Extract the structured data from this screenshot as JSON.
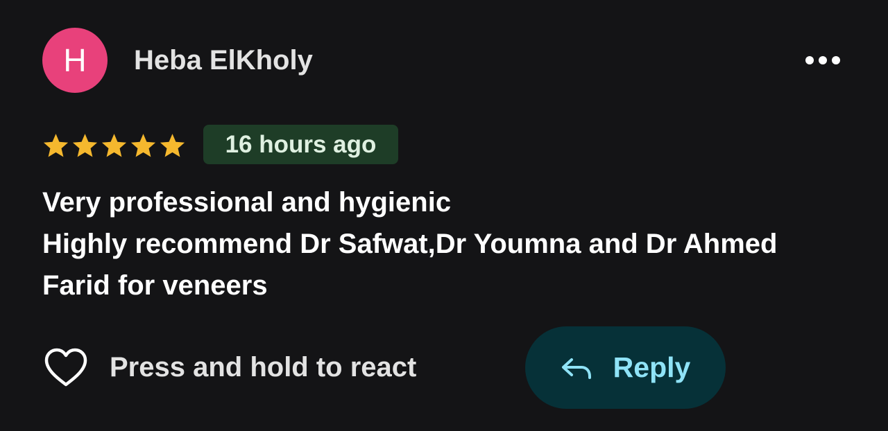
{
  "review": {
    "avatar_initial": "H",
    "author_name": "Heba ElKholy",
    "rating": 5,
    "rating_max": 5,
    "time_ago": "16 hours ago",
    "text_lines": [
      "Very professional and hygienic",
      "Highly recommend Dr Safwat,Dr Youmna and Dr Ahmed",
      "Farid for veneers"
    ]
  },
  "actions": {
    "react_label": "Press and hold to react",
    "reply_label": "Reply",
    "more_icon": "more-horizontal-icon",
    "heart_icon": "heart-outline-icon",
    "reply_icon": "reply-arrow-icon"
  },
  "colors": {
    "background": "#141416",
    "avatar": "#e8417b",
    "star": "#f5b82e",
    "time_badge_bg": "#1e3d27",
    "reply_bg": "#063138",
    "reply_text": "#8fe3f7"
  }
}
